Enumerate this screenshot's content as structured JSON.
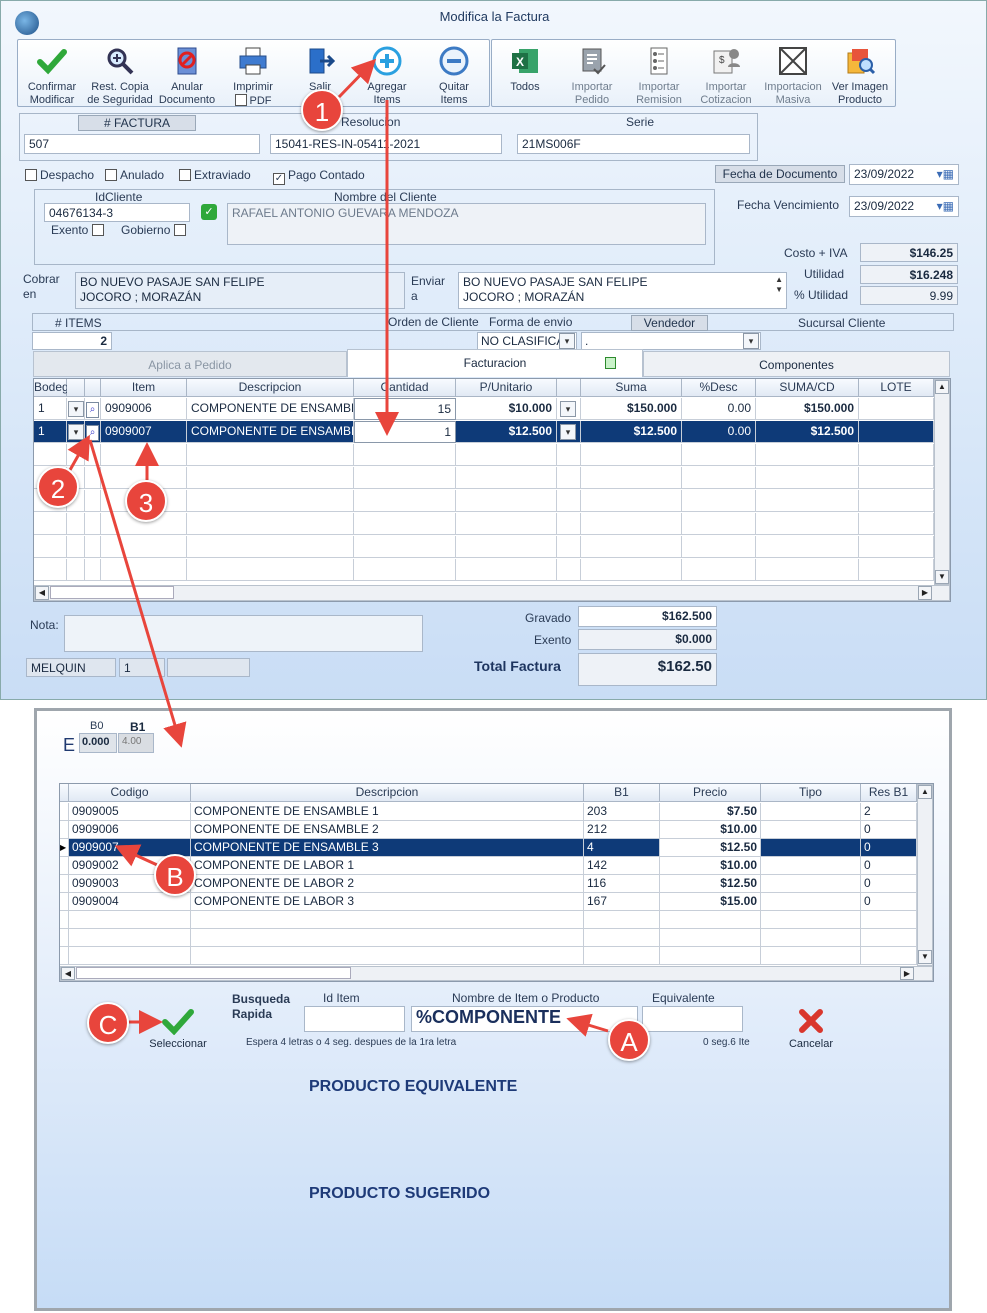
{
  "window": {
    "title": "Modifica la Factura"
  },
  "toolbar": [
    {
      "label1": "Confirmar",
      "label2": "Modificar",
      "icon": "check-icon"
    },
    {
      "label1": "Rest. Copia",
      "label2": "de Seguridad",
      "icon": "magnifier-icon"
    },
    {
      "label1": "Anular",
      "label2": "Documento",
      "icon": "cancel-doc-icon"
    },
    {
      "label1": "Imprimir",
      "label2": "PDF",
      "icon": "printer-icon"
    },
    {
      "label1": "Salir",
      "label2": "",
      "icon": "exit-icon"
    },
    {
      "label1": "Agregar",
      "label2": "Items",
      "icon": "plus-circle-icon"
    },
    {
      "label1": "Quitar",
      "label2": "Items",
      "icon": "minus-circle-icon"
    },
    {
      "label1": "Todos",
      "label2": "",
      "icon": "excel-icon"
    },
    {
      "label1": "Importar",
      "label2": "Pedido",
      "icon": "import-order-icon"
    },
    {
      "label1": "Importar",
      "label2": "Remision",
      "icon": "import-remision-icon"
    },
    {
      "label1": "Importar",
      "label2": "Cotizacion",
      "icon": "import-quote-icon"
    },
    {
      "label1": "Importacion",
      "label2": "Masiva",
      "icon": "mass-import-icon"
    },
    {
      "label1": "Ver Imagen",
      "label2": "Producto",
      "icon": "image-icon"
    }
  ],
  "header": {
    "factura_label": "# FACTURA",
    "factura": "507",
    "resolucion_label": "Resolucion",
    "resolucion": "15041-RES-IN-05411-2021",
    "serie_label": "Serie",
    "serie": "21MS006F"
  },
  "flags": {
    "despacho": "Despacho",
    "anulado": "Anulado",
    "extraviado": "Extraviado",
    "pago": "Pago Contado"
  },
  "fechas": {
    "doc_label": "Fecha de  Documento",
    "doc": "23/09/2022",
    "venc_label": "Fecha Vencimiento",
    "venc": "23/09/2022"
  },
  "cliente": {
    "id_label": "IdCliente",
    "id": "04676134-3",
    "nombre_label": "Nombre del Cliente",
    "nombre": "RAFAEL ANTONIO GUEVARA MENDOZA",
    "exento": "Exento",
    "gobierno": "Gobierno"
  },
  "costos": {
    "costo_label": "Costo + IVA",
    "costo": "$146.25",
    "util_label": "Utilidad",
    "util": "$16.248",
    "pct_label": "% Utilidad",
    "pct": "9.99"
  },
  "direcciones": {
    "cobrar_label1": "Cobrar",
    "cobrar_label2": "en",
    "cobrar1": "BO NUEVO PASAJE SAN FELIPE",
    "cobrar2": "JOCORO ; MORAZÁN",
    "enviar_label1": "Enviar",
    "enviar_label2": "a",
    "enviar1": "BO NUEVO PASAJE SAN FELIPE",
    "enviar2": "JOCORO ; MORAZÁN"
  },
  "info": {
    "items_label": "# ITEMS",
    "items": "2",
    "orden_label": "Orden de Cliente",
    "envio_label": "Forma de envio",
    "envio": "NO CLASIFICA",
    "vendedor_label": "Vendedor",
    "vendedor": ".",
    "sucursal_label": "Sucursal Cliente"
  },
  "tabs": [
    "Aplica a Pedido",
    "Facturacion",
    "Componentes"
  ],
  "grid1": {
    "columns": [
      "Bodega",
      "",
      "Item",
      "Descripcion",
      "Cantidad",
      "P/Unitario",
      "",
      "Suma",
      "%Desc",
      "SUMA/CD",
      "LOTE"
    ],
    "rows": [
      [
        "1",
        "",
        "0909006",
        "COMPONENTE DE ENSAMBL",
        "15",
        "$10.000",
        "",
        "$150.000",
        "0.00",
        "$150.000",
        ""
      ],
      [
        "1",
        "",
        "0909007",
        "COMPONENTE DE ENSAMBL",
        "1",
        "$12.500",
        "",
        "$12.500",
        "0.00",
        "$12.500",
        ""
      ]
    ]
  },
  "totales": {
    "nota_label": "Nota:",
    "gravado_label": "Gravado",
    "gravado": "$162.500",
    "exento_label": "Exento",
    "exento": "$0.000",
    "total_label": "Total Factura",
    "total": "$162.50",
    "user": "MELQUIN",
    "num": "1"
  },
  "callouts": {
    "n1": "1",
    "n2": "2",
    "n3": "3",
    "a": "A",
    "b": "B",
    "c": "C"
  },
  "search": {
    "b0_label": "B0",
    "b0": "0.000",
    "b1_label": "B1",
    "b1": "4.00",
    "e": "E",
    "columns": [
      "Codigo",
      "Descripcion",
      "B1",
      "Precio",
      "Tipo",
      "Res B1"
    ],
    "rows": [
      [
        "0909005",
        "COMPONENTE DE ENSAMBLE 1",
        "203",
        "$7.50",
        "",
        "2"
      ],
      [
        "0909006",
        "COMPONENTE DE ENSAMBLE 2",
        "212",
        "$10.00",
        "",
        "0"
      ],
      [
        "0909007",
        "COMPONENTE DE ENSAMBLE 3",
        "4",
        "$12.50",
        "",
        "0"
      ],
      [
        "0909002",
        "COMPONENTE DE LABOR 1",
        "142",
        "$10.00",
        "",
        "0"
      ],
      [
        "0909003",
        "COMPONENTE DE LABOR 2",
        "116",
        "$12.50",
        "",
        "0"
      ],
      [
        "0909004",
        "COMPONENTE DE LABOR 3",
        "167",
        "$15.00",
        "",
        "0"
      ]
    ],
    "busqueda1": "Busqueda",
    "busqueda2": "Rapida",
    "id_label": "Id Item",
    "nombre_label": "Nombre de Item o Producto",
    "equiv_label": "Equivalente",
    "query": "%COMPONENTE",
    "hint": "Espera 4 letras o 4 seg. despues de la 1ra letra",
    "timer": "0 seg.6 Ite",
    "select": "Seleccionar",
    "cancel": "Cancelar",
    "equivalente": "PRODUCTO EQUIVALENTE",
    "sugerido": "PRODUCTO SUGERIDO"
  },
  "colors": {
    "selected": "#0e3a78",
    "callout": "#e8453c",
    "arrow": "#e8453c"
  }
}
